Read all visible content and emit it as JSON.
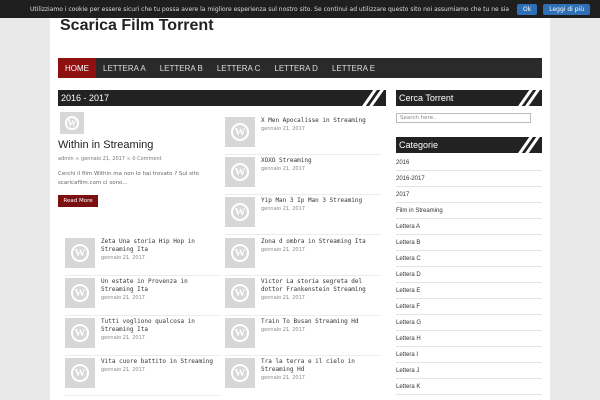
{
  "cookie": {
    "message": "Utilizziamo i cookie per essere sicuri che tu possa avere la migliore esperienza sul nostro sito. Se continui ad utilizzare questo sito noi assumiamo che tu ne sia felice.",
    "ok_label": "Ok",
    "more_label": "Leggi di più"
  },
  "site": {
    "title": "Scarica Film Torrent"
  },
  "nav": {
    "items": [
      "HOME",
      "LETTERA A",
      "LETTERA B",
      "LETTERA C",
      "LETTERA D",
      "LETTERA E"
    ]
  },
  "main": {
    "heading": "2016 - 2017",
    "featured": {
      "title": "Within in Streaming",
      "meta": "admin  ≈ gennaio 21, 2017  ≈ 0 Comment",
      "excerpt": "Cerchi il film Within ma non lo hai trovato ? Sul sito scaricafilm.com ci sono...",
      "read_more": "Read More"
    },
    "left_posts": [
      {
        "title": "Zeta Una storia Hip Hop in Streaming Ita",
        "date": "gennaio 21, 2017"
      },
      {
        "title": "Un estate in Provenza in Streaming Ita",
        "date": "gennaio 21, 2017"
      },
      {
        "title": "Tutti vogliono qualcosa in Streaming Ita",
        "date": "gennaio 21, 2017"
      },
      {
        "title": "Vita cuore battito in Streaming",
        "date": "gennaio 21, 2017"
      }
    ],
    "right_posts": [
      {
        "title": "X Men Apocalisse in Streaming",
        "date": "gennaio 21, 2017"
      },
      {
        "title": "XOXO Streaming",
        "date": "gennaio 21, 2017"
      },
      {
        "title": "Yip Man 3 Ip Man 3 Streaming",
        "date": "gennaio 21, 2017"
      },
      {
        "title": "Zona d ombra in Streaming Ita",
        "date": "gennaio 21, 2017"
      },
      {
        "title": "Victor La storia segreta del dottor Frankenstein Streaming",
        "date": "gennaio 21, 2017"
      },
      {
        "title": "Train To Busan Streaming Hd",
        "date": "gennaio 21, 2017"
      },
      {
        "title": "Tra la terra e il cielo in Streaming Hd",
        "date": "gennaio 21, 2017"
      }
    ]
  },
  "sidebar": {
    "search_heading": "Cerca Torrent",
    "search_placeholder": "Search here..",
    "categories_heading": "Categorie",
    "categories": [
      "2016",
      "2016-2017",
      "2017",
      "Film in Streaming",
      "Lettera A",
      "Lettera B",
      "Lettera C",
      "Lettera D",
      "Lettera E",
      "Lettera F",
      "Lettera G",
      "Lettera H",
      "Lettera I",
      "Lettera J",
      "Lettera K"
    ]
  },
  "colors": {
    "nav_bg": "#2a2a2a",
    "nav_active": "#8e1010",
    "cookie_button": "#2f6fb5"
  }
}
